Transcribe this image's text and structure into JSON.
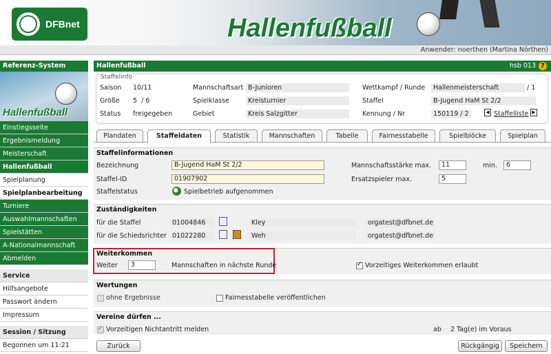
{
  "header": {
    "logo_text": "DFBnet",
    "title": "Hallenfußball",
    "user_text": "Anwender: noerthen (Martina Nörthen)"
  },
  "sidebar": {
    "ref_title": "Referenz-System",
    "image_title": "Hallenfußball",
    "items": [
      "Einstiegsseite",
      "Ergebnismeldung",
      "Meisterschaft"
    ],
    "active": "Hallenfußball",
    "sub": "Spielplanung",
    "section": "Spielplanbearbeitung",
    "items2": [
      "Turniere",
      "Auswahlmannschaften",
      "Spielstätten",
      "A-Nationalmannschaft",
      "Abmelden"
    ],
    "service_title": "Service",
    "service_items": [
      "Hilfsangebote",
      "Passwort ändern",
      "Impressum"
    ],
    "session_title": "Session / Sitzung",
    "session_text": "Begonnen um 11:21"
  },
  "main": {
    "title": "Hallenfußball",
    "code": "hsb 013",
    "help": "?"
  },
  "staffelinfo": {
    "legend": "Staffelinfo",
    "saison_label": "Saison",
    "saison": "10/11",
    "groesse_label": "Größe",
    "groesse": "5  / 6",
    "status_label": "Status",
    "status": "freigegeben",
    "mannschaftsart_label": "Mannschaftsart",
    "mannschaftsart": "B-Junioren",
    "spielklasse_label": "Spielklasse",
    "spielklasse": "Kreisturnier",
    "gebiet_label": "Gebiet",
    "gebiet": "Kreis Salzgitter",
    "wettkampf_label": "Wettkampf / Runde",
    "wettkampf": "Hallenmeisterschaft",
    "runde": "/ 1",
    "staffel_label": "Staffel",
    "staffel": "B-Jugend HaM St 2/2",
    "kennung_label": "Kennung / Nr",
    "kennung": "150119 / 2",
    "staffelliste": "Staffelliste"
  },
  "tabs": [
    "Plandaten",
    "Staffeldaten",
    "Statistik",
    "Mannschaften",
    "Tabelle",
    "Fairnesstabelle",
    "Spielblöcke",
    "Spielplan"
  ],
  "staffelinformationen": {
    "title": "Staffelinformationen",
    "bezeichnung_label": "Bezeichnung",
    "bezeichnung": "B-Jugend HaM St 2/2",
    "staffelid_label": "Staffel-ID",
    "staffelid": "01907902",
    "status_label": "Staffelstatus",
    "status": "Spielbetrieb aufgenommen",
    "mstaerke_label": "Mannschaftsstärke max.",
    "mstaerke": "11",
    "min_label": "min.",
    "min": "6",
    "ersatz_label": "Ersatzspieler max.",
    "ersatz": "5"
  },
  "zustaendigkeiten": {
    "title": "Zuständigkeiten",
    "rows": [
      {
        "label": "für die Staffel",
        "nr": "01004846",
        "name": "Kley",
        "email": "orgatest@dfbnet.de"
      },
      {
        "label": "für die Schiedsrichter",
        "nr": "01022280",
        "name": "Weh",
        "email": "orgatest@dfbnet.de"
      }
    ]
  },
  "weiterkommen": {
    "title": "Weiterkommen",
    "weiter_label": "Weiter",
    "weiter": "3",
    "text": "Mannschaften in nächste Runde",
    "vorzeitig": "Vorzeitiges Weiterkommen erlaubt"
  },
  "wertungen": {
    "title": "Wertungen",
    "ohne": "ohne Ergebnisse",
    "fair": "Fairnesstabelle veröffentlichen"
  },
  "vereine": {
    "title": "Vereine dürfen ...",
    "nichtantritt": "Vorzeitigen Nichtantritt melden",
    "ab_label": "ab",
    "ab_value": "2 Tag(e) im Voraus"
  },
  "buttons": {
    "zurueck": "Zurück",
    "rueckgaengig": "Rückgängig",
    "speichern": "Speichern"
  },
  "colors": {
    "accent": "#1a7a33",
    "highlight": "#cc1f2d"
  }
}
